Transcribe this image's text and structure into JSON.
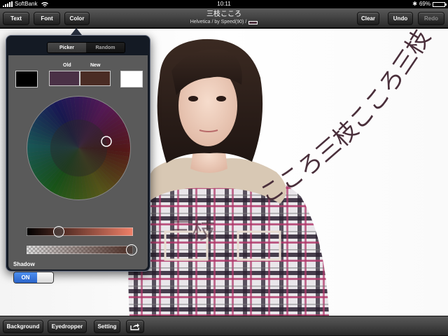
{
  "status": {
    "carrier": "SoftBank",
    "time": "10:11",
    "battery": "69%",
    "battery_level": 0.69
  },
  "toolbar": {
    "text_label": "Text",
    "font_label": "Font",
    "color_label": "Color",
    "clear_label": "Clear",
    "undo_label": "Undo",
    "redo_label": "Redo"
  },
  "document": {
    "title": "三枝こころ",
    "subtitle": "Helvetica / by Speed(90) /",
    "text_color": "#4a2f3b"
  },
  "canvas_text": {
    "curve": "こころ三枝こころ三枝",
    "baseline": "三枝"
  },
  "color_picker": {
    "tabs": [
      "Picker",
      "Random"
    ],
    "old_label": "Old",
    "new_label": "New",
    "old_color": "#4a3146",
    "new_color": "#4a2c24",
    "left_swatch": "#000000",
    "right_swatch": "#ffffff",
    "brightness": 0.3,
    "opacity": 1.0
  },
  "shadow": {
    "label": "Shadow",
    "toggle_label": "ON"
  },
  "bottom": {
    "background_label": "Background",
    "eyedropper_label": "Eyedropper",
    "setting_label": "Setting",
    "share_icon": "share-icon"
  }
}
